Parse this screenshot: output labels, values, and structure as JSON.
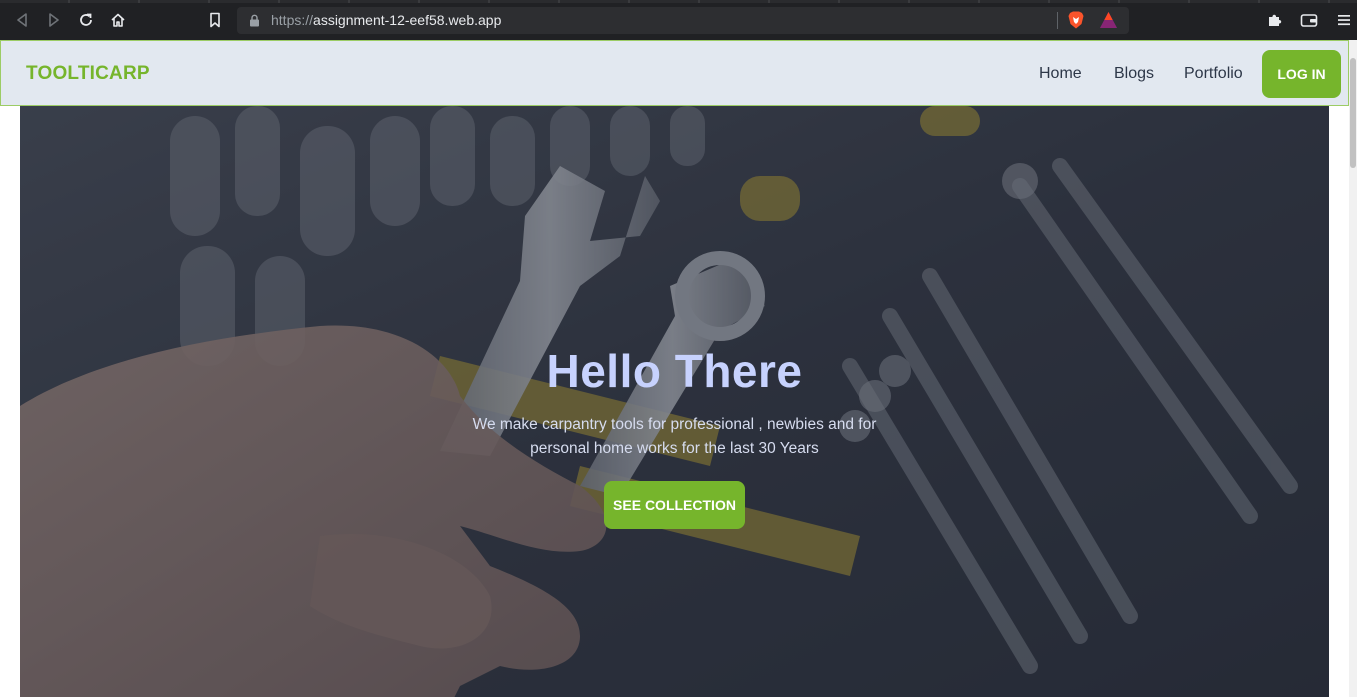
{
  "browser": {
    "url_scheme": "https://",
    "url_host": "assignment-12-eef58.web.app"
  },
  "header": {
    "brand": "TOOLTICARP",
    "nav": {
      "home": "Home",
      "blogs": "Blogs",
      "portfolio": "Portfolio"
    },
    "login_label": "LOG IN"
  },
  "hero": {
    "title": "Hello There",
    "text": "We make carpantry tools for professional , newbies and for personal home works for the last 30 Years",
    "button_label": "SEE COLLECTION"
  },
  "colors": {
    "accent": "#76b52c",
    "header_bg": "#e2e8f0",
    "hero_title": "#c7d2fe"
  }
}
